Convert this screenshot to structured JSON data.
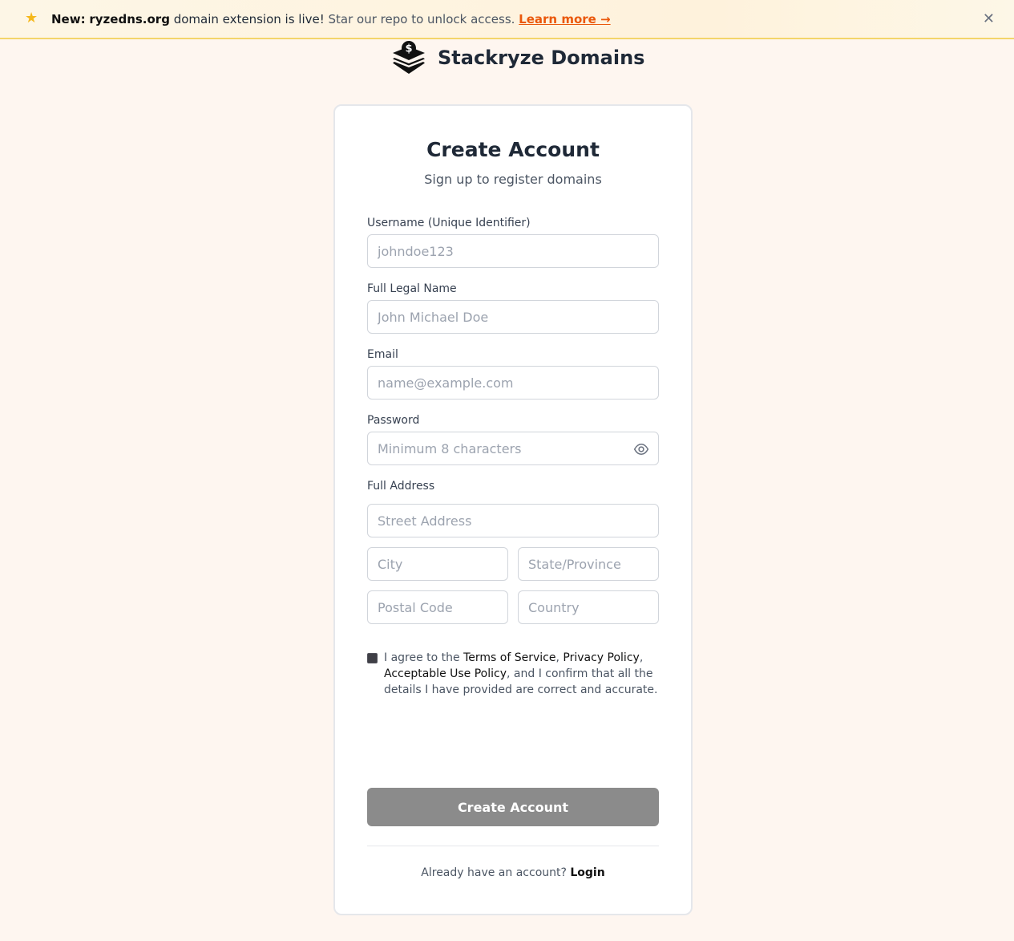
{
  "banner": {
    "icon": "star-icon",
    "new_label": "New:",
    "domain": "ryzedns.org",
    "text_a": " domain extension is live! ",
    "text_b": "Star our repo to unlock access. ",
    "link": "Learn more →",
    "close": "✕"
  },
  "brand": {
    "name": "Stackryze Domains",
    "logo_icon": "stack-dollar-icon"
  },
  "card": {
    "title": "Create Account",
    "subtitle": "Sign up to register domains"
  },
  "form": {
    "username": {
      "label": "Username (Unique Identifier)",
      "placeholder": "johndoe123",
      "value": ""
    },
    "full_name": {
      "label": "Full Legal Name",
      "placeholder": "John Michael Doe",
      "value": ""
    },
    "email": {
      "label": "Email",
      "placeholder": "name@example.com",
      "value": ""
    },
    "password": {
      "label": "Password",
      "placeholder": "Minimum 8 characters",
      "value": "",
      "toggle_icon": "eye-icon"
    },
    "address": {
      "label": "Full Address",
      "street_placeholder": "Street Address",
      "city_placeholder": "City",
      "state_placeholder": "State/Province",
      "postal_placeholder": "Postal Code",
      "country_placeholder": "Country"
    },
    "agree": {
      "prefix": "I agree to the ",
      "tos": "Terms of Service",
      "sep1": ", ",
      "privacy": "Privacy Policy",
      "sep2": ", ",
      "aup": "Acceptable Use Policy",
      "suffix": ", and I confirm that all the details I have provided are correct and accurate.",
      "checked": false
    },
    "submit_label": "Create Account"
  },
  "footer": {
    "text": "Already have an account? ",
    "link": "Login"
  },
  "colors": {
    "page_bg": "#fef6f0",
    "banner_border": "#f3d56a",
    "link_accent": "#ea580c",
    "submit_bg": "#8b8b8b"
  }
}
